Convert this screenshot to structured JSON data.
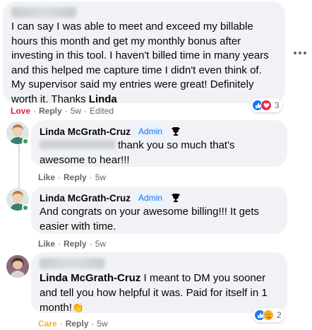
{
  "comment1": {
    "author_redacted": "",
    "text": "I can say I was able to meet and exceed my billable hours this month and get my monthly bonus after investing in this tool. I haven't billed time in many years and this helped me capture time I didn't even think of. My supervisor said my entries were great! Definitely worth it. Thanks ",
    "mention": "Linda",
    "reaction": "Love",
    "reply": "Reply",
    "time": "5w",
    "edited": "Edited",
    "reaction_count": "3"
  },
  "reply1": {
    "author": "Linda McGrath-Cruz",
    "badge": "Admin",
    "text": "thank you so much that's awesome to hear!!!",
    "like": "Like",
    "reply": "Reply",
    "time": "5w"
  },
  "reply2": {
    "author": "Linda McGrath-Cruz",
    "badge": "Admin",
    "text": "And congrats on your awesome billing!!! It gets easier with time.",
    "like": "Like",
    "reply": "Reply",
    "time": "5w"
  },
  "reply3": {
    "author_redacted": "",
    "mention": "Linda McGrath-Cruz",
    "text": " I meant to DM you sooner and tell you how helpful it was. Paid for itself in 1 month!",
    "emoji": "👏",
    "reaction": "Care",
    "reply": "Reply",
    "time": "5w",
    "reaction_count": "2"
  },
  "colors": {
    "bubble": "#f0f2f5",
    "link": "#216fdb",
    "love": "#e41e3f",
    "care": "#f7b125",
    "meta": "#65676b"
  }
}
